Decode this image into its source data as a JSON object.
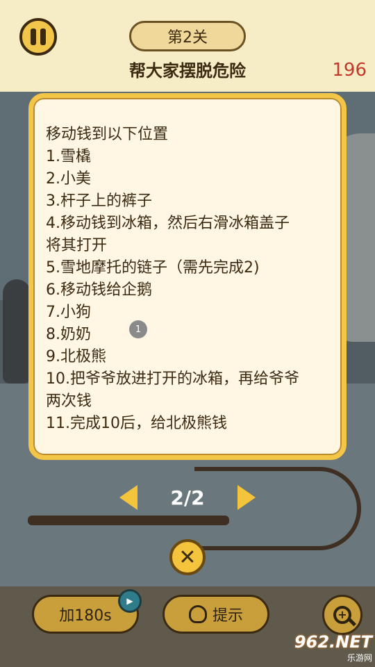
{
  "header": {
    "level": "第2关",
    "subtitle": "帮大家摆脱危险",
    "timer": "196"
  },
  "panel": {
    "title": "移动钱到以下位置",
    "lines": [
      "1.雪橇",
      "2.小美",
      "3.杆子上的裤子",
      "4.移动钱到冰箱，然后右滑冰箱盖子",
      "将其打开",
      "5.雪地摩托的链子（需先完成2)",
      "6.移动钱给企鹅",
      "7.小狗",
      "8.奶奶",
      "9.北极熊",
      "10.把爷爷放进打开的冰箱，再给爷爷",
      "两次钱",
      "11.完成10后，给北极熊钱"
    ],
    "badge": "1"
  },
  "pager": {
    "indicator": "2/2",
    "close_glyph": "✕"
  },
  "bottom": {
    "add_time_label": "加180s",
    "hint_label": "提示",
    "zoom_glyph": "+"
  },
  "watermark": {
    "logo": "962.NET",
    "site": "乐游网"
  },
  "colors": {
    "accent": "#f4c53c",
    "timer": "#c0392b",
    "panel_bg": "#fff6e4"
  }
}
